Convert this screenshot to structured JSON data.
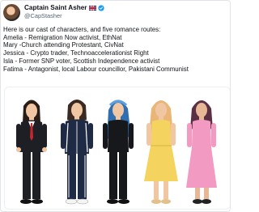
{
  "author": {
    "display_name": "Captain Saint Asher",
    "handle": "@CapStasher",
    "flag_icon": "uk-flag-icon",
    "verified_icon": "verified-badge-icon",
    "verified_color": "#1d9bf0"
  },
  "tweet": {
    "lines": [
      "Here is our cast of characters, and five romance routes:",
      "Amelia - Remigration Now activist, EthNat",
      "Mary -Church attending Protestant, CivNat",
      "Jessica - Crypto trader, Technoaccelerationist Right",
      "Isla - Former SNP voter, Scottish Independence activist",
      "Fatima - Antagonist, local Labour councillor, Pakistani Communist"
    ]
  },
  "image": {
    "characters": [
      {
        "id": "amelia",
        "outfit": "black suit, red tie",
        "hair_color": "#2a1d16"
      },
      {
        "id": "mary",
        "outfit": "navy tracksuit",
        "hair_color": "#3a2a22"
      },
      {
        "id": "jessica",
        "outfit": "black top, black trousers",
        "hair_color": "#2f6fb0"
      },
      {
        "id": "isla",
        "outfit": "yellow dress",
        "hair_color": "#e9b678"
      },
      {
        "id": "fatima",
        "outfit": "pink dress",
        "hair_color": "#5b2f44"
      }
    ]
  }
}
